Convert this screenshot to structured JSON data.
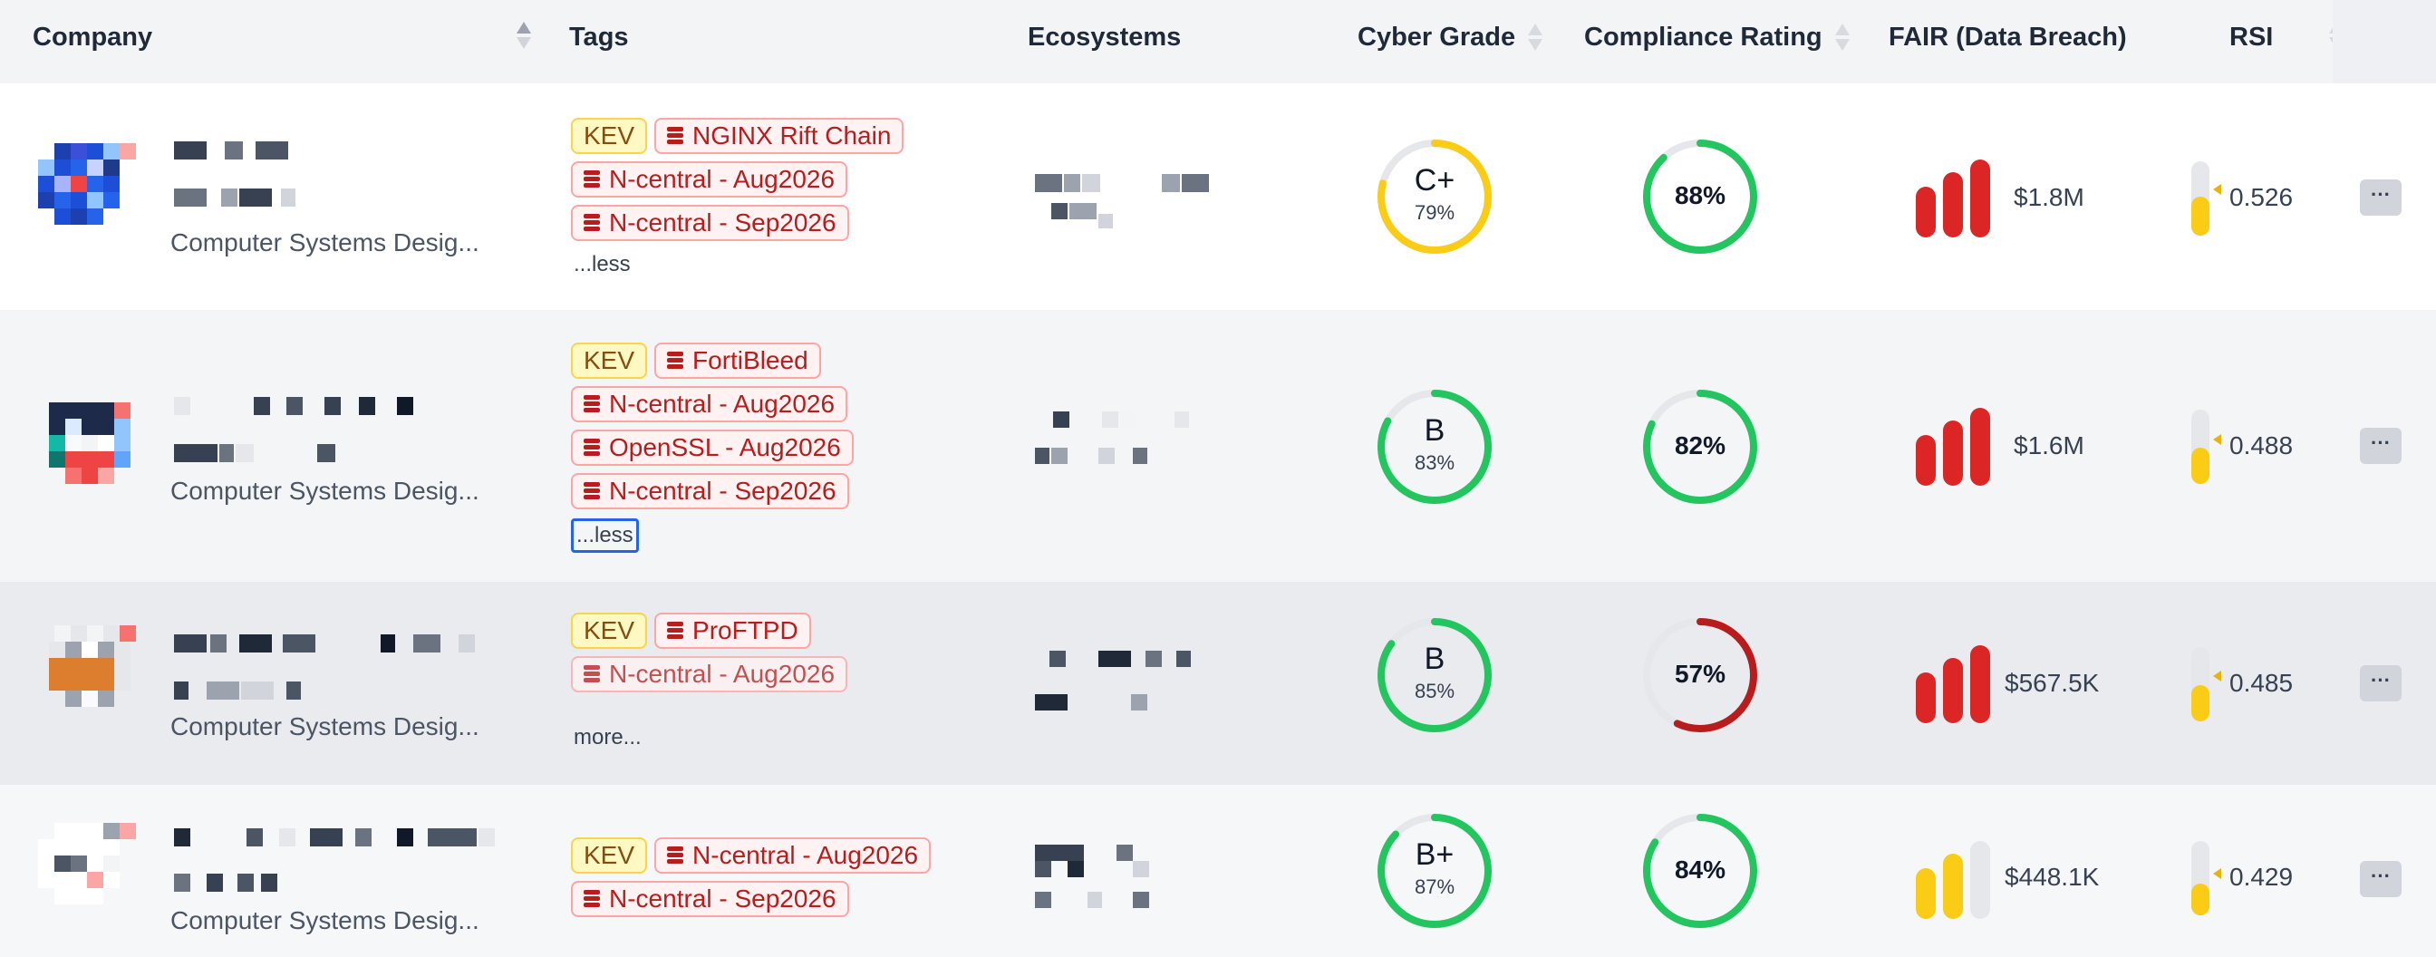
{
  "header": {
    "company": "Company",
    "tags": "Tags",
    "ecosystems": "Ecosystems",
    "cyber_grade": "Cyber Grade",
    "compliance_rating": "Compliance Rating",
    "fair": "FAIR (Data Breach)",
    "rsi": "RSI"
  },
  "rows": [
    {
      "industry": "Computer Systems Desig...",
      "tags": [
        "KEV",
        "NGINX Rift Chain",
        "N-central - Aug2026",
        "N-central - Sep2026"
      ],
      "toggle": "...less",
      "grade": "C+",
      "grade_pct": "79%",
      "grade_value": 0.79,
      "grade_color": "#facc15",
      "compliance": "88%",
      "compliance_value": 0.88,
      "compliance_color": "#22c55e",
      "fair": "$1.8M",
      "fair_color": "#dc2626",
      "fair_level": 3,
      "rsi": "0.526",
      "rsi_value": 0.526,
      "more": "···"
    },
    {
      "industry": "Computer Systems Desig...",
      "tags": [
        "KEV",
        "FortiBleed",
        "N-central - Aug2026",
        "OpenSSL - Aug2026",
        "N-central - Sep2026"
      ],
      "toggle": "...less",
      "grade": "B",
      "grade_pct": "83%",
      "grade_value": 0.83,
      "grade_color": "#22c55e",
      "compliance": "82%",
      "compliance_value": 0.82,
      "compliance_color": "#22c55e",
      "fair": "$1.6M",
      "fair_color": "#dc2626",
      "fair_level": 3,
      "rsi": "0.488",
      "rsi_value": 0.488,
      "more": "···"
    },
    {
      "industry": "Computer Systems Desig...",
      "tags": [
        "KEV",
        "ProFTPD",
        "N-central - Aug2026"
      ],
      "toggle": "more...",
      "grade": "B",
      "grade_pct": "85%",
      "grade_value": 0.85,
      "grade_color": "#22c55e",
      "compliance": "57%",
      "compliance_value": 0.57,
      "compliance_color": "#b91c1c",
      "fair": "$567.5K",
      "fair_color": "#dc2626",
      "fair_level": 3,
      "rsi": "0.485",
      "rsi_value": 0.485,
      "more": "···"
    },
    {
      "industry": "Computer Systems Desig...",
      "tags": [
        "KEV",
        "N-central - Aug2026",
        "N-central - Sep2026"
      ],
      "toggle": "",
      "grade": "B+",
      "grade_pct": "87%",
      "grade_value": 0.87,
      "grade_color": "#22c55e",
      "compliance": "84%",
      "compliance_value": 0.84,
      "compliance_color": "#22c55e",
      "fair": "$448.1K",
      "fair_color": "#facc15",
      "fair_level": 2,
      "rsi": "0.429",
      "rsi_value": 0.429,
      "more": "···"
    }
  ]
}
